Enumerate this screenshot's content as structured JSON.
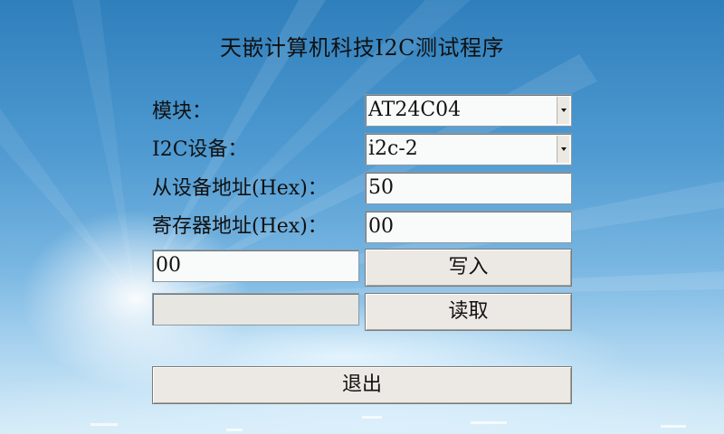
{
  "app": {
    "title": "天嵌计算机科技I2C测试程序"
  },
  "form": {
    "module_label": "模块：",
    "module_value": "AT24C04",
    "device_label": "I2C设备：",
    "device_value": "i2c-2",
    "slave_addr_label": "从设备地址(Hex)：",
    "slave_addr_value": "50",
    "reg_addr_label": "寄存器地址(Hex)：",
    "reg_addr_value": "00",
    "write_data_value": "00",
    "read_data_value": ""
  },
  "buttons": {
    "write": "写入",
    "read": "读取",
    "exit": "退出"
  },
  "icons": {
    "dropdown": "chevron-down-icon"
  }
}
